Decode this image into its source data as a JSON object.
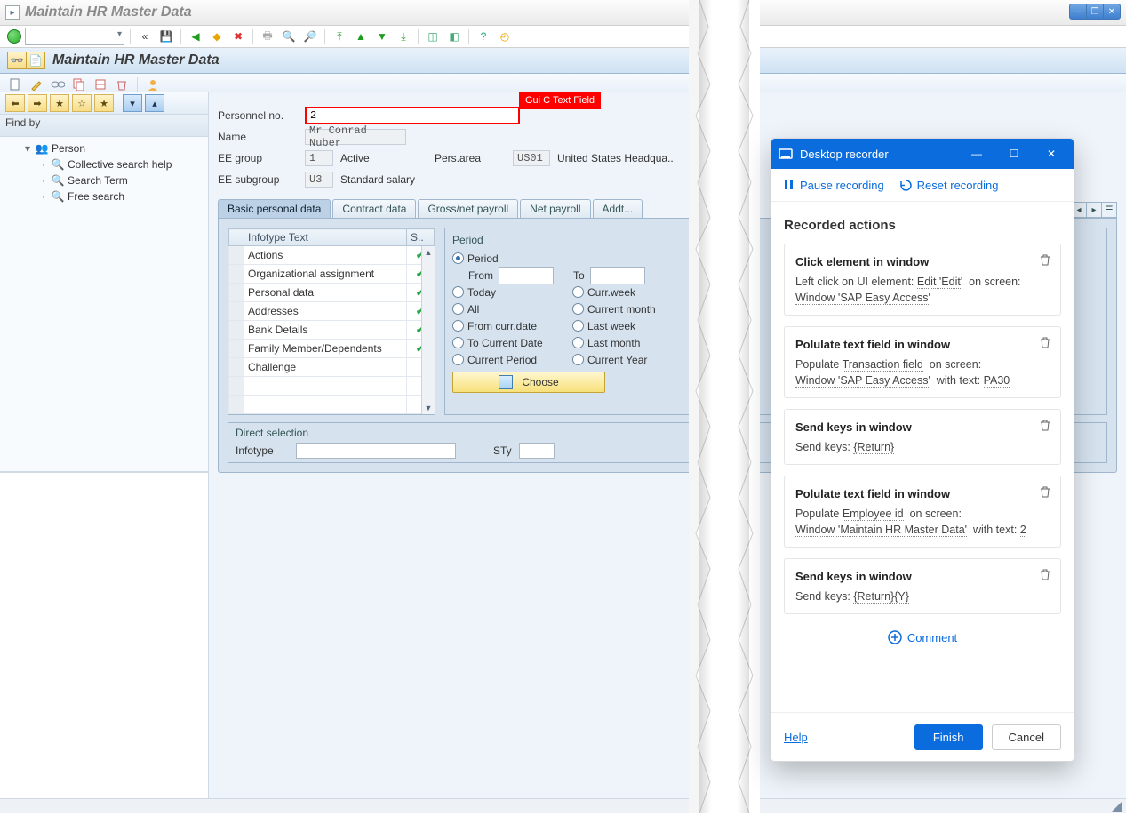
{
  "window_title": "Maintain HR Master Data",
  "screen_title": "Maintain HR Master Data",
  "leftnav": {
    "header": "Find by",
    "root": "Person",
    "items": [
      "Collective search help",
      "Search Term",
      "Free search"
    ]
  },
  "highlight_label": "Gui C Text Field",
  "form": {
    "personnel_no": {
      "label": "Personnel no.",
      "value": "2"
    },
    "name": {
      "label": "Name",
      "value": "Mr Conrad Nuber"
    },
    "ee_group": {
      "label": "EE group",
      "code": "1",
      "text": "Active"
    },
    "pers_area": {
      "label": "Pers.area",
      "code": "US01",
      "text": "United States Headqua.."
    },
    "ee_subgroup": {
      "label": "EE subgroup",
      "code": "U3",
      "text": "Standard salary"
    }
  },
  "tabs": {
    "items": [
      "Basic personal data",
      "Contract data",
      "Gross/net payroll",
      "Net payroll",
      "Addt..."
    ],
    "active": 0
  },
  "grid": {
    "cols": [
      "Infotype Text",
      "S.."
    ],
    "rows": [
      {
        "text": "Actions",
        "status": true
      },
      {
        "text": "Organizational assignment",
        "status": true
      },
      {
        "text": "Personal data",
        "status": true
      },
      {
        "text": "Addresses",
        "status": true
      },
      {
        "text": "Bank Details",
        "status": true
      },
      {
        "text": "Family Member/Dependents",
        "status": true
      },
      {
        "text": "Challenge",
        "status": false
      }
    ]
  },
  "period": {
    "title": "Period",
    "from_label": "From",
    "to_label": "To",
    "options_left": [
      "Period",
      "Today",
      "All",
      "From curr.date",
      "To Current Date",
      "Current Period"
    ],
    "options_right": [
      "Curr.week",
      "Current month",
      "Last week",
      "Last month",
      "Current Year"
    ],
    "selected": "Period",
    "choose_label": "Choose"
  },
  "direct": {
    "title": "Direct selection",
    "infotype_label": "Infotype",
    "sty_label": "STy"
  },
  "recorder": {
    "title": "Desktop recorder",
    "pause": "Pause recording",
    "reset": "Reset recording",
    "heading": "Recorded actions",
    "cards": [
      {
        "title": "Click element in window",
        "lines": [
          {
            "prefix": "Left click on UI element:",
            "u1": "Edit 'Edit'",
            "mid": "on screen:"
          },
          {
            "u1": "Window 'SAP Easy Access'"
          }
        ]
      },
      {
        "title": "Polulate text field in window",
        "lines": [
          {
            "prefix": "Populate",
            "u1": "Transaction field",
            "mid": "on screen:"
          },
          {
            "u1": "Window 'SAP Easy Access'",
            "mid": "with text:",
            "u2": "PA30"
          }
        ]
      },
      {
        "title": "Send keys in window",
        "lines": [
          {
            "prefix": "Send keys:",
            "u1": "{Return}"
          }
        ]
      },
      {
        "title": "Polulate text field in window",
        "lines": [
          {
            "prefix": "Populate",
            "u1": "Employee id",
            "mid": "on screen:"
          },
          {
            "u1": "Window 'Maintain HR Master Data'",
            "mid": "with text:",
            "u2": "2"
          }
        ]
      },
      {
        "title": "Send keys in window",
        "lines": [
          {
            "prefix": "Send keys:",
            "u1": "{Return}{Y}"
          }
        ]
      }
    ],
    "comment": "Comment",
    "help": "Help",
    "finish": "Finish",
    "cancel": "Cancel"
  }
}
